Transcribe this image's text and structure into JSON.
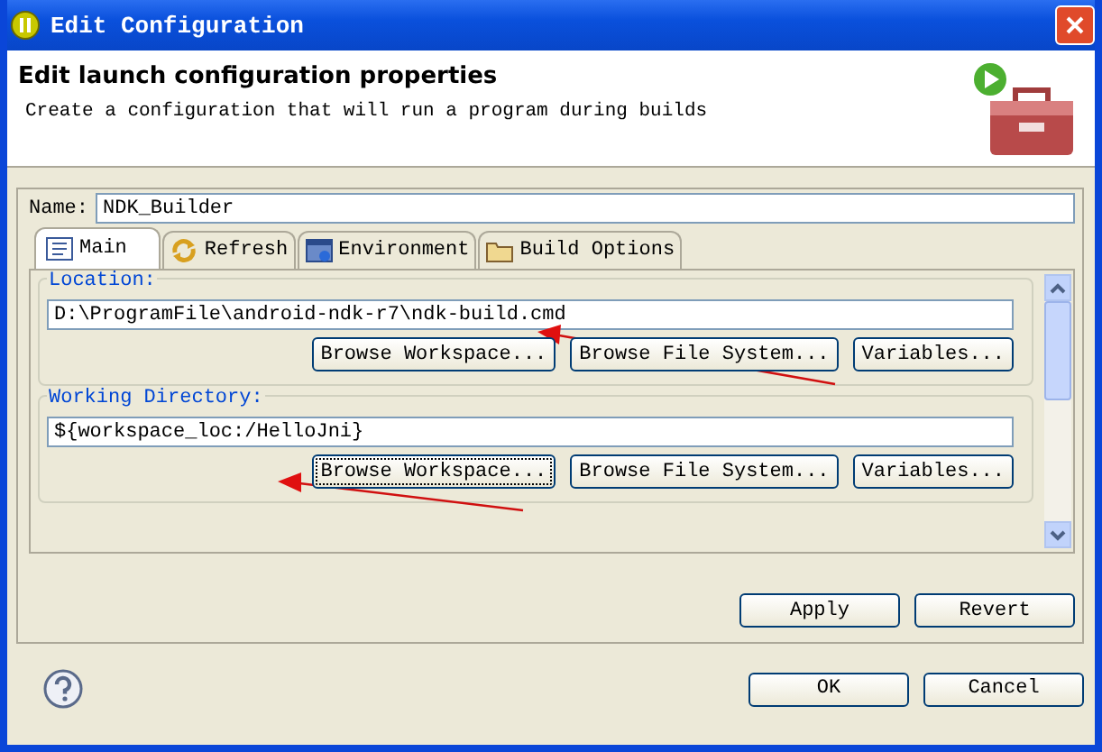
{
  "window": {
    "title": "Edit Configuration"
  },
  "header": {
    "title": "Edit launch configuration properties",
    "description": "Create a configuration that will run a program during builds"
  },
  "name_field": {
    "label": "Name:",
    "value": "NDK_Builder"
  },
  "tabs": [
    {
      "label": "Main",
      "kind": "main",
      "selected": true
    },
    {
      "label": "Refresh",
      "kind": "refresh",
      "selected": false
    },
    {
      "label": "Environment",
      "kind": "environment",
      "selected": false
    },
    {
      "label": "Build Options",
      "kind": "folder",
      "selected": false
    }
  ],
  "groups": [
    {
      "label": "Location:",
      "value": "D:\\ProgramFile\\android-ndk-r7\\ndk-build.cmd",
      "buttons": [
        {
          "label": "Browse Workspace...",
          "focused": false
        },
        {
          "label": "Browse File System...",
          "focused": false
        },
        {
          "label": "Variables...",
          "focused": false
        }
      ]
    },
    {
      "label": "Working Directory:",
      "value": "${workspace_loc:/HelloJni}",
      "buttons": [
        {
          "label": "Browse Workspace...",
          "focused": true
        },
        {
          "label": "Browse File System...",
          "focused": false
        },
        {
          "label": "Variables...",
          "focused": false
        }
      ]
    }
  ],
  "tab_buttons": [
    "Apply",
    "Revert"
  ],
  "dialog_buttons": [
    "OK",
    "Cancel"
  ]
}
